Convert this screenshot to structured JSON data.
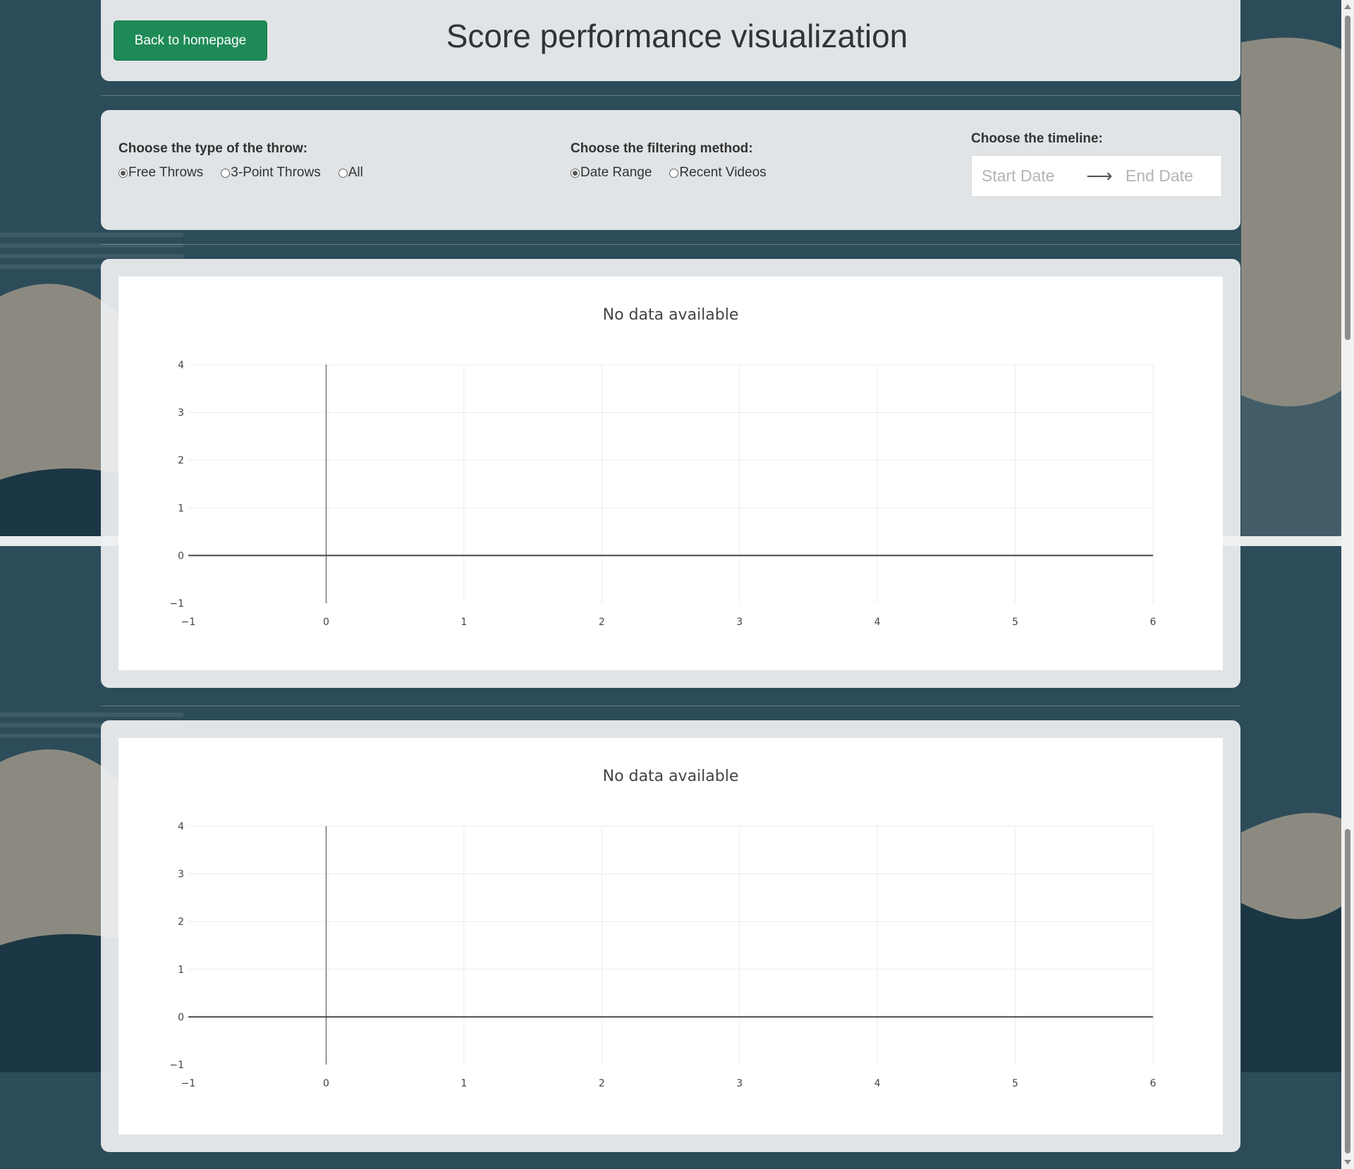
{
  "header": {
    "back_label": "Back to homepage",
    "title": "Score performance visualization"
  },
  "filters": {
    "throw_type": {
      "label": "Choose the type of the throw:",
      "options": [
        "Free Throws",
        "3-Point Throws",
        "All"
      ],
      "selected": "Free Throws"
    },
    "filter_method": {
      "label": "Choose the filtering method:",
      "options": [
        "Date Range",
        "Recent Videos"
      ],
      "selected": "Date Range"
    },
    "timeline": {
      "label": "Choose the timeline:",
      "start_placeholder": "Start Date",
      "end_placeholder": "End Date"
    }
  },
  "colors": {
    "primary_button": "#1e8a57",
    "background": "#2c4a58"
  },
  "chart_data": [
    {
      "type": "line",
      "title": "No data available",
      "series": [],
      "xlim": [
        -1,
        6
      ],
      "ylim": [
        -1,
        4
      ],
      "xticks": [
        -1,
        0,
        1,
        2,
        3,
        4,
        5,
        6
      ],
      "yticks": [
        -1,
        0,
        1,
        2,
        3,
        4
      ],
      "grid": true
    },
    {
      "type": "line",
      "title": "No data available",
      "series": [],
      "xlim": [
        -1,
        6
      ],
      "ylim": [
        -1,
        4
      ],
      "xticks": [
        -1,
        0,
        1,
        2,
        3,
        4,
        5,
        6
      ],
      "yticks": [
        -1,
        0,
        1,
        2,
        3,
        4
      ],
      "grid": true
    }
  ]
}
